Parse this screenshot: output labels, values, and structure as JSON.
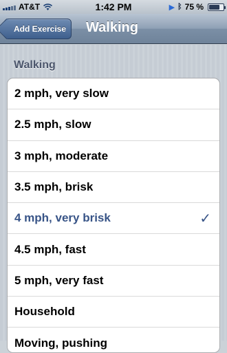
{
  "status_bar": {
    "carrier": "AT&T",
    "time": "1:42 PM",
    "battery_percent_label": "75 %",
    "battery_level": 0.75,
    "icons": [
      "signal-icon",
      "wifi-icon",
      "play-icon",
      "bluetooth-icon",
      "battery-icon"
    ]
  },
  "nav_bar": {
    "back_label": "Add Exercise",
    "title": "Walking"
  },
  "section": {
    "header": "Walking",
    "items": [
      {
        "label": "2 mph, very slow",
        "selected": false
      },
      {
        "label": "2.5 mph, slow",
        "selected": false
      },
      {
        "label": "3 mph, moderate",
        "selected": false
      },
      {
        "label": "3.5 mph, brisk",
        "selected": false
      },
      {
        "label": "4 mph, very brisk",
        "selected": true
      },
      {
        "label": "4.5 mph, fast",
        "selected": false
      },
      {
        "label": "5 mph, very fast",
        "selected": false
      },
      {
        "label": "Household",
        "selected": false
      },
      {
        "label": "Moving, pushing",
        "selected": false
      }
    ]
  },
  "colors": {
    "selected_text": "#385487",
    "nav_gradient_top": "#b8c4d2",
    "back_button": "#3e5f8d"
  },
  "checkmark_glyph": "✓"
}
